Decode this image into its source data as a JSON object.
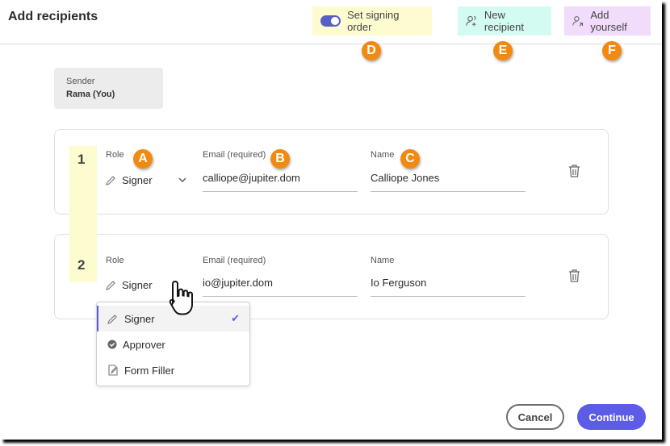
{
  "header": {
    "title": "Add recipients",
    "signing_order": "Set signing order",
    "new_recipient": "New recipient",
    "add_yourself": "Add yourself"
  },
  "callouts": {
    "a": "A",
    "b": "B",
    "c": "C",
    "d": "D",
    "e": "E",
    "f": "F"
  },
  "sender": {
    "label": "Sender",
    "name": "Rama (You)"
  },
  "recipients": [
    {
      "number": "1",
      "role_label": "Role",
      "role": "Signer",
      "email_label": "Email (required)",
      "email": "calliope@jupiter.dom",
      "name_label": "Name",
      "name": "Calliope Jones"
    },
    {
      "number": "2",
      "role_label": "Role",
      "role": "Signer",
      "email_label": "Email (required)",
      "email": "io@jupiter.dom",
      "name_label": "Name",
      "name": "Io Ferguson"
    }
  ],
  "role_menu": {
    "items": [
      {
        "label": "Signer",
        "icon": "pen-icon",
        "selected": true
      },
      {
        "label": "Approver",
        "icon": "check-circle-icon"
      },
      {
        "label": "Form Filler",
        "icon": "form-icon"
      }
    ]
  },
  "footer": {
    "cancel": "Cancel",
    "continue": "Continue"
  },
  "colors": {
    "accent": "#5c5ce6",
    "callout": "#f28a0f"
  }
}
